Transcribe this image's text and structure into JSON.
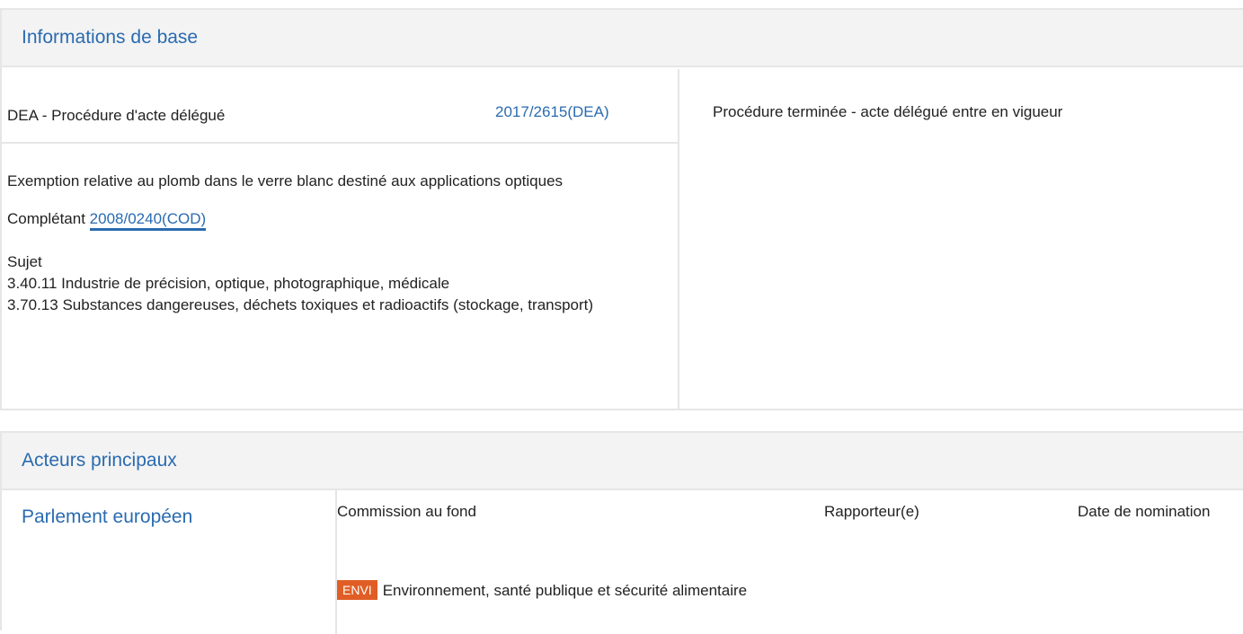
{
  "basic": {
    "title": "Informations de base",
    "procedure_type": "DEA - Procédure d'acte délégué",
    "procedure_ref": "2017/2615(DEA)",
    "status": "Procédure terminée - acte délégué entre en vigueur",
    "description": "Exemption relative au plomb dans le verre blanc destiné aux applications optiques",
    "completes_label": "Complétant",
    "completes_ref": "2008/0240(COD)",
    "subject_label": "Sujet",
    "subjects": [
      "3.40.11 Industrie de précision, optique, photographique, médicale",
      "3.70.13 Substances dangereuses, déchets toxiques et radioactifs (stockage, transport)"
    ]
  },
  "actors": {
    "title": "Acteurs principaux",
    "institution": "Parlement européen",
    "headers": {
      "committee": "Commission au fond",
      "rapporteur": "Rapporteur(e)",
      "date": "Date de nomination"
    },
    "committee": {
      "badge": "ENVI",
      "badge_color": "#e05e25",
      "name": "Environnement, santé publique et sécurité alimentaire"
    }
  },
  "colors": {
    "link": "#2a6bb0",
    "header_bg": "#f3f3f3",
    "border": "#e6e6e6"
  }
}
